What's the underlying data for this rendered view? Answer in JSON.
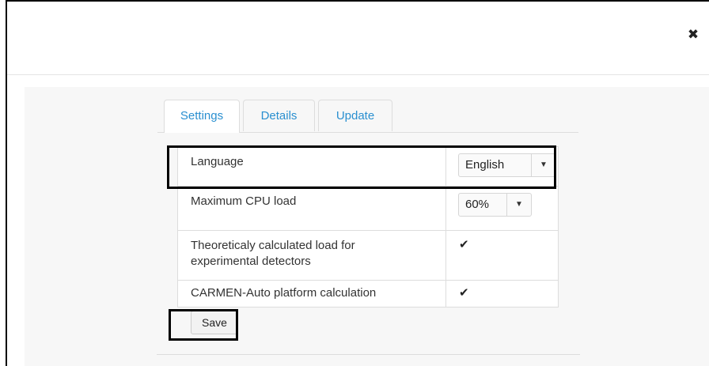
{
  "modal": {
    "close_icon": "close-icon",
    "close_glyph": "✖"
  },
  "tabs": [
    {
      "label": "Settings",
      "active": true
    },
    {
      "label": "Details",
      "active": false
    },
    {
      "label": "Update",
      "active": false
    }
  ],
  "settings": {
    "language": {
      "label": "Language",
      "value": "English",
      "icon": "caret-down-icon"
    },
    "cpu_load": {
      "label": "Maximum CPU load",
      "value": "60%",
      "icon": "caret-down-icon"
    },
    "theoretical_load": {
      "label_line1": "Theoreticaly calculated load for",
      "label_line2": "experimental detectors",
      "checked": true,
      "icon": "checkmark-icon"
    },
    "carmen_auto": {
      "label": "CARMEN-Auto platform calculation",
      "checked": true,
      "icon": "checkmark-icon"
    }
  },
  "glyphs": {
    "caret": "▼",
    "check": "✔"
  },
  "save_label": "Save",
  "colors": {
    "tab_link": "#2a8fd0",
    "highlight": "#000000",
    "body_bg": "#f7f7f7"
  }
}
